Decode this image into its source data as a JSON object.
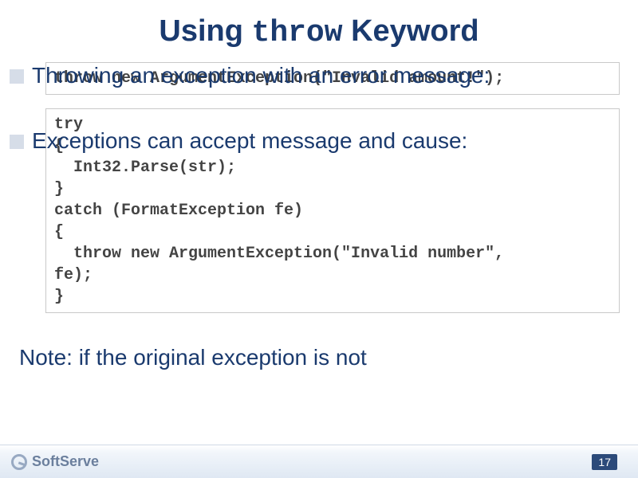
{
  "title_pre": "Using ",
  "title_mono": "throw",
  "title_post": " Keyword",
  "bullet1": "Throwing an exception with an error message:",
  "code1": "throw new ArgumentException(\"Invalid amount!\");",
  "bullet2": "Exceptions can accept message and cause:",
  "code2": "try\n{\n  Int32.Parse(str);\n}\ncatch (FormatException fe)\n{\n  throw new ArgumentException(\"Invalid number\",\nfe);\n}",
  "note_label": "Note",
  "note_rest": ": if the original exception is not",
  "brand": "SoftServe",
  "page": "17"
}
